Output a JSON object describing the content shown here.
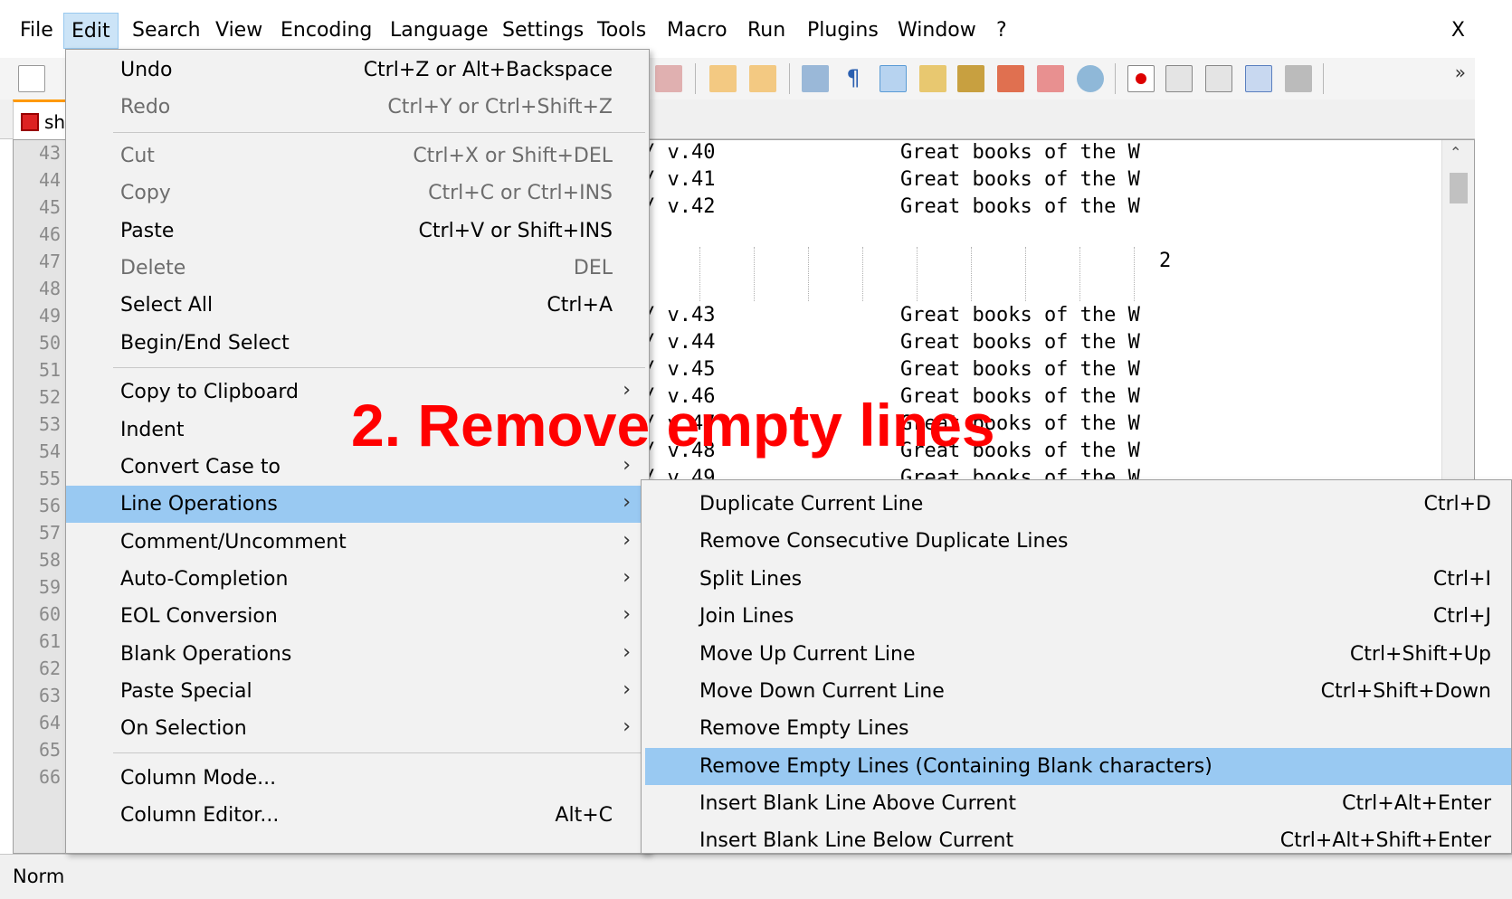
{
  "menubar": {
    "items": [
      "File",
      "Edit",
      "Search",
      "View",
      "Encoding",
      "Language",
      "Settings",
      "Tools",
      "Macro",
      "Run",
      "Plugins",
      "Window",
      "?"
    ],
    "active": "Edit",
    "close": "X"
  },
  "tab": {
    "label": "sh"
  },
  "editor": {
    "line_numbers": [
      "43",
      "44",
      "45",
      "46",
      "47",
      "48",
      "49",
      "50",
      "51",
      "52",
      "53",
      "54",
      "55",
      "56",
      "57",
      "58",
      "59",
      "60",
      "61",
      "62",
      "63",
      "64",
      "65",
      "66"
    ],
    "lines": [
      {
        "left": "/ v.40",
        "right": "Great books of the W"
      },
      {
        "left": "/ v.41",
        "right": "Great books of the W"
      },
      {
        "left": "/ v.42",
        "right": "Great books of the W"
      },
      {
        "left": "",
        "right": "2"
      },
      {
        "left": "/ v.43",
        "right": "Great books of the W"
      },
      {
        "left": "/ v.44",
        "right": "Great books of the W"
      },
      {
        "left": "/ v.45",
        "right": "Great books of the W"
      },
      {
        "left": "/ v.46",
        "right": "Great books of the W"
      },
      {
        "left": "/ v.47",
        "right": "Great books of the W"
      },
      {
        "left": "/ v.48",
        "right": "Great books of the W"
      },
      {
        "left": "/ v.49",
        "right": "Great books of the W"
      }
    ]
  },
  "status": {
    "text": "Norm"
  },
  "edit_menu": {
    "items": [
      {
        "label": "Undo",
        "shortcut": "Ctrl+Z or Alt+Backspace"
      },
      {
        "label": "Redo",
        "shortcut": "Ctrl+Y or Ctrl+Shift+Z"
      },
      {
        "label": "Cut",
        "shortcut": "Ctrl+X or Shift+DEL"
      },
      {
        "label": "Copy",
        "shortcut": "Ctrl+C or Ctrl+INS"
      },
      {
        "label": "Paste",
        "shortcut": "Ctrl+V or Shift+INS"
      },
      {
        "label": "Delete",
        "shortcut": "DEL"
      },
      {
        "label": "Select All",
        "shortcut": "Ctrl+A"
      },
      {
        "label": "Begin/End Select",
        "shortcut": ""
      },
      {
        "label": "Copy to Clipboard",
        "shortcut": ""
      },
      {
        "label": "Indent",
        "shortcut": ""
      },
      {
        "label": "Convert Case to",
        "shortcut": ""
      },
      {
        "label": "Line Operations",
        "shortcut": ""
      },
      {
        "label": "Comment/Uncomment",
        "shortcut": ""
      },
      {
        "label": "Auto-Completion",
        "shortcut": ""
      },
      {
        "label": "EOL Conversion",
        "shortcut": ""
      },
      {
        "label": "Blank Operations",
        "shortcut": ""
      },
      {
        "label": "Paste Special",
        "shortcut": ""
      },
      {
        "label": "On Selection",
        "shortcut": ""
      },
      {
        "label": "Column Mode...",
        "shortcut": ""
      },
      {
        "label": "Column Editor...",
        "shortcut": "Alt+C"
      }
    ]
  },
  "line_ops_menu": {
    "items": [
      {
        "label": "Duplicate Current Line",
        "shortcut": "Ctrl+D"
      },
      {
        "label": "Remove Consecutive Duplicate Lines",
        "shortcut": ""
      },
      {
        "label": "Split Lines",
        "shortcut": "Ctrl+I"
      },
      {
        "label": "Join Lines",
        "shortcut": "Ctrl+J"
      },
      {
        "label": "Move Up Current Line",
        "shortcut": "Ctrl+Shift+Up"
      },
      {
        "label": "Move Down Current Line",
        "shortcut": "Ctrl+Shift+Down"
      },
      {
        "label": "Remove Empty Lines",
        "shortcut": ""
      },
      {
        "label": "Remove Empty Lines (Containing Blank characters)",
        "shortcut": ""
      },
      {
        "label": "Insert Blank Line Above Current",
        "shortcut": "Ctrl+Alt+Enter"
      },
      {
        "label": "Insert Blank Line Below Current",
        "shortcut": "Ctrl+Alt+Shift+Enter"
      }
    ]
  },
  "annotation": {
    "text": "2. Remove empty lines",
    "color": "#ff0000"
  },
  "colors": {
    "highlight": "#99c9f2",
    "menu_bg": "#f2f2f2",
    "menu_active": "#cce4f7"
  }
}
